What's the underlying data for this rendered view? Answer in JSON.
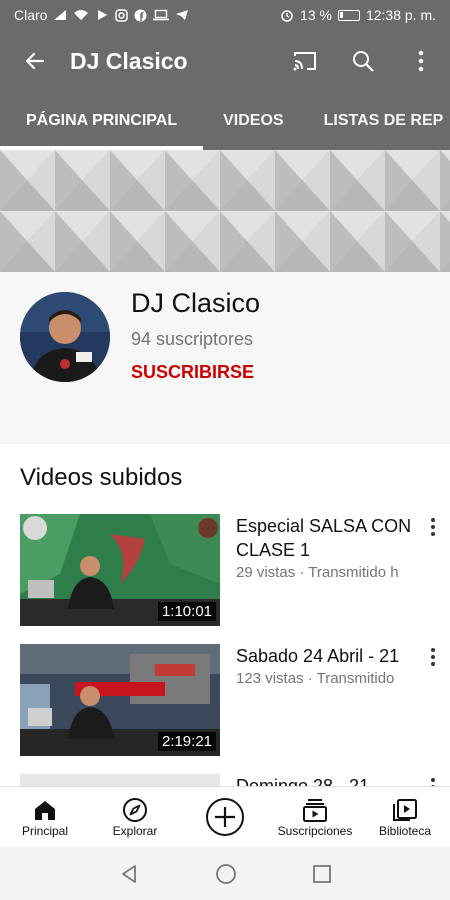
{
  "status_bar": {
    "carrier": "Claro",
    "battery": "13 %",
    "time": "12:38 p. m."
  },
  "app_bar": {
    "title": "DJ Clasico",
    "icons": [
      "back-arrow-icon",
      "cast-icon",
      "search-icon",
      "more-vert-icon"
    ]
  },
  "tabs": [
    {
      "label": "PÁGINA PRINCIPAL",
      "active": true
    },
    {
      "label": "VIDEOS",
      "active": false
    },
    {
      "label": "LISTAS DE REP",
      "active": false
    }
  ],
  "channel": {
    "name": "DJ Clasico",
    "subscribers": "94 suscriptores",
    "subscribe_label": "SUSCRIBIRSE"
  },
  "section": {
    "title": "Videos subidos"
  },
  "videos": [
    {
      "title": "Especial  SALSA CON CLASE 1",
      "meta": "29 vistas · Transmitido h",
      "duration": "1:10:01"
    },
    {
      "title": "Sabado 24 Abril - 21",
      "meta": "123 vistas · Transmitido",
      "duration": "2:19:21"
    },
    {
      "title": "Domingo 28 - 21",
      "meta": "",
      "duration": ""
    }
  ],
  "bottom_nav": [
    {
      "label": "Principal",
      "icon": "home-icon"
    },
    {
      "label": "Explorar",
      "icon": "compass-icon"
    },
    {
      "label": "",
      "icon": "add-circle-icon"
    },
    {
      "label": "Suscripciones",
      "icon": "subscriptions-icon"
    },
    {
      "label": "Biblioteca",
      "icon": "library-icon"
    }
  ],
  "colors": {
    "header_bg": "#6b6b6b",
    "subscribe_red": "#cc0000",
    "channel_bg": "#f7f7f7"
  }
}
